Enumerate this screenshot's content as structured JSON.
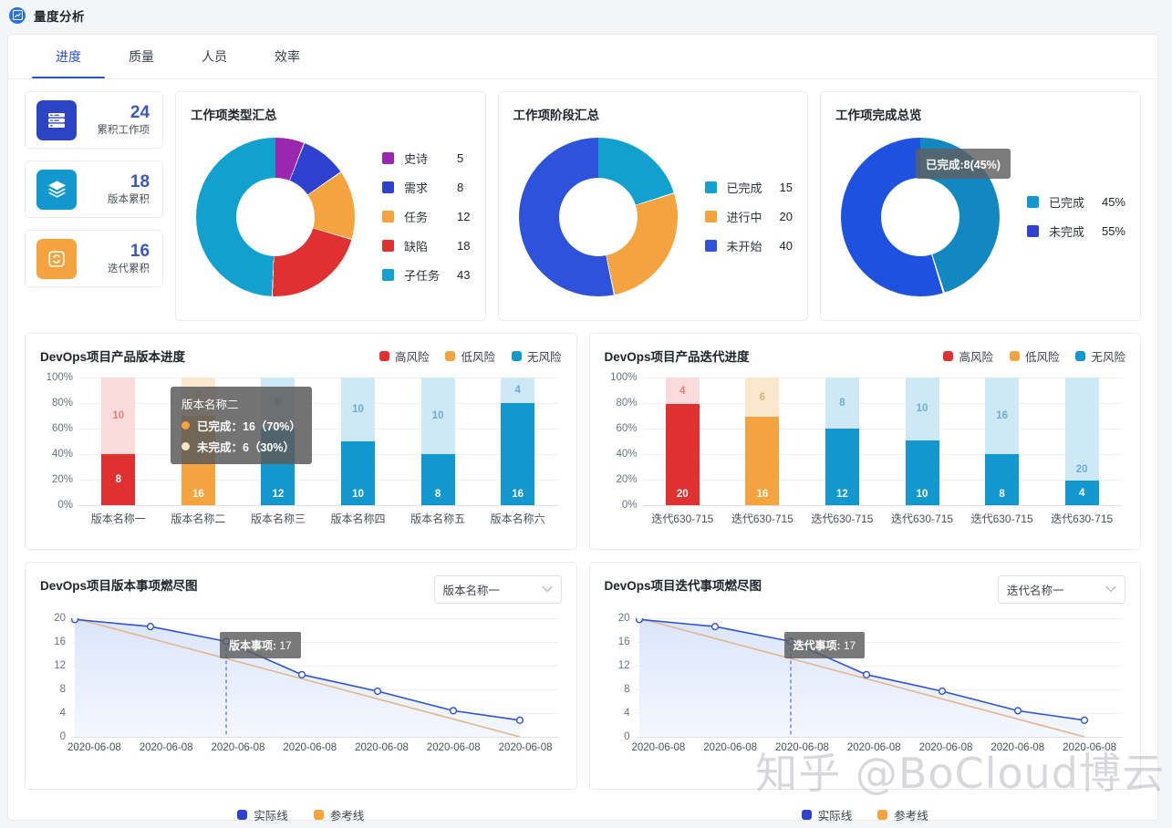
{
  "header": {
    "title": "量度分析",
    "icon": "chart-square-icon"
  },
  "tabs": [
    {
      "label": "进度",
      "active": true
    },
    {
      "label": "质量",
      "active": false
    },
    {
      "label": "人员",
      "active": false
    },
    {
      "label": "效率",
      "active": false
    }
  ],
  "stats": [
    {
      "value": "24",
      "label": "累积工作项",
      "icon": "server-list-icon",
      "color": "#2c44c4"
    },
    {
      "value": "18",
      "label": "版本累积",
      "icon": "layers-icon",
      "color": "#1297cf"
    },
    {
      "value": "16",
      "label": "迭代累积",
      "icon": "refresh-cycle-icon",
      "color": "#f5a33f"
    }
  ],
  "chart_data": [
    {
      "type": "pie",
      "title": "工作项类型汇总",
      "labels": [
        "史诗",
        "需求",
        "任务",
        "缺陷",
        "子任务"
      ],
      "values": [
        5,
        8,
        12,
        18,
        43
      ],
      "colors": [
        "#9b27b0",
        "#2f41cf",
        "#f5a33f",
        "#e03131",
        "#12a0cf"
      ],
      "legend": "right",
      "donut": true
    },
    {
      "type": "pie",
      "title": "工作项阶段汇总",
      "labels": [
        "已完成",
        "进行中",
        "未开始"
      ],
      "values": [
        15,
        20,
        40
      ],
      "colors": [
        "#12a0cf",
        "#f5a33f",
        "#2f52da"
      ],
      "legend": "right",
      "donut": true
    },
    {
      "type": "pie",
      "title": "工作项完成总览",
      "labels": [
        "已完成",
        "未完成"
      ],
      "values": [
        45,
        55
      ],
      "value_labels": [
        "45%",
        "55%"
      ],
      "colors": [
        "#1287c0",
        "#1e51e0"
      ],
      "legend": "right",
      "donut": true,
      "tooltip": "已完成:8(45%)"
    },
    {
      "type": "bar",
      "title": "DevOps项目产品版本进度",
      "stacked": true,
      "categories": [
        "版本名称一",
        "版本名称二",
        "版本名称三",
        "版本名称四",
        "版本名称五",
        "版本名称六"
      ],
      "ylim": [
        0,
        100
      ],
      "yticks": [
        "0%",
        "20%",
        "40%",
        "60%",
        "80%",
        "100%"
      ],
      "ylabel": "",
      "series": [
        {
          "name": "已完成",
          "values": [
            8,
            16,
            12,
            10,
            8,
            16
          ],
          "percent": [
            40,
            70,
            60,
            50,
            40,
            80
          ]
        },
        {
          "name": "未完成",
          "values": [
            10,
            6,
            8,
            10,
            10,
            4
          ],
          "percent": [
            60,
            30,
            40,
            50,
            60,
            20
          ]
        }
      ],
      "risk": [
        "高风险",
        "低风险",
        "无风险",
        "无风险",
        "无风险",
        "无风险"
      ],
      "legend": [
        "高风险",
        "低风险",
        "无风险"
      ],
      "legend_colors": [
        "#e03131",
        "#f5a33f",
        "#1297cf"
      ],
      "tooltip": {
        "title": "版本名称二",
        "rows": [
          {
            "label": "已完成：16（70%）",
            "color": "#f5a33f"
          },
          {
            "label": "未完成：6（30%）",
            "color": "#f6e3c8"
          }
        ]
      }
    },
    {
      "type": "bar",
      "title": "DevOps项目产品迭代进度",
      "stacked": true,
      "categories": [
        "迭代630-715",
        "迭代630-715",
        "迭代630-715",
        "迭代630-715",
        "迭代630-715",
        "迭代630-715"
      ],
      "ylim": [
        0,
        100
      ],
      "yticks": [
        "0%",
        "20%",
        "40%",
        "60%",
        "80%",
        "100%"
      ],
      "series": [
        {
          "name": "已完成",
          "values": [
            20,
            16,
            12,
            10,
            8,
            4
          ],
          "percent": [
            79,
            69,
            60,
            51,
            40,
            19
          ]
        },
        {
          "name": "未完成",
          "values": [
            4,
            6,
            8,
            10,
            16,
            20
          ],
          "percent": [
            21,
            31,
            40,
            49,
            60,
            81
          ]
        }
      ],
      "risk": [
        "高风险",
        "低风险",
        "无风险",
        "无风险",
        "无风险",
        "无风险"
      ],
      "legend": [
        "高风险",
        "低风险",
        "无风险"
      ],
      "legend_colors": [
        "#e03131",
        "#f5a33f",
        "#1297cf"
      ]
    },
    {
      "type": "line",
      "title": "DevOps项目版本事项燃尽图",
      "selector": "版本名称一",
      "ylim": [
        0,
        20
      ],
      "yticks": [
        "0",
        "4",
        "8",
        "12",
        "16",
        "20"
      ],
      "x": [
        "2020-06-08",
        "2020-06-08",
        "2020-06-08",
        "2020-06-08",
        "2020-06-08",
        "2020-06-08",
        "2020-06-08"
      ],
      "series": [
        {
          "name": "实际线",
          "values": [
            19.8,
            18.6,
            16.1,
            10.5,
            7.7,
            4.4,
            2.8
          ],
          "color": "#2f52da"
        },
        {
          "name": "参考线",
          "values": [
            20,
            16.7,
            13.3,
            10,
            6.7,
            3.3,
            0
          ],
          "color": "#e3b68d"
        }
      ],
      "legend": [
        "实际线",
        "参考线"
      ],
      "legend_colors": [
        "#2f52da",
        "#f5a33f"
      ],
      "tooltip": {
        "label": "版本事项:",
        "value": "17",
        "at_index": 2
      }
    },
    {
      "type": "line",
      "title": "DevOps项目迭代事项燃尽图",
      "selector": "迭代名称一",
      "ylim": [
        0,
        20
      ],
      "yticks": [
        "0",
        "4",
        "8",
        "12",
        "16",
        "20"
      ],
      "x": [
        "2020-06-08",
        "2020-06-08",
        "2020-06-08",
        "2020-06-08",
        "2020-06-08",
        "2020-06-08",
        "2020-06-08"
      ],
      "series": [
        {
          "name": "实际线",
          "values": [
            19.8,
            18.6,
            16.1,
            10.5,
            7.7,
            4.4,
            2.8
          ],
          "color": "#2f52da"
        },
        {
          "name": "参考线",
          "values": [
            20,
            16.7,
            13.3,
            10,
            6.7,
            3.3,
            0
          ],
          "color": "#e3b68d"
        }
      ],
      "legend": [
        "实际线",
        "参考线"
      ],
      "legend_colors": [
        "#2f52da",
        "#f5a33f"
      ],
      "tooltip": {
        "label": "迭代事项:",
        "value": "17",
        "at_index": 2
      }
    }
  ],
  "watermark": "知乎 @BoCloud博云",
  "colors": {
    "accent": "#2c52d8",
    "red": "#e03131",
    "red_light": "#fadbdb",
    "orange": "#f5a33f",
    "orange_light": "#fbe7cd",
    "cyan": "#1297cf",
    "cyan_light": "#cfe8f5",
    "blue": "#2f52da",
    "purple": "#9b27b0"
  }
}
